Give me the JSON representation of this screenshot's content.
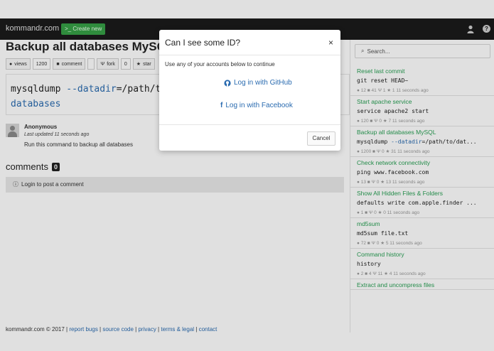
{
  "navbar": {
    "brand": "kommandr.com",
    "create_label": ">_ Create new"
  },
  "main": {
    "title": "Backup all databases MySQL",
    "buttons": [
      {
        "icon": "eye-icon",
        "label": "views",
        "count": "1200"
      },
      {
        "icon": "comment-icon",
        "label": "comment",
        "count": ""
      },
      {
        "icon": "fork-icon",
        "label": "fork",
        "count": "0"
      },
      {
        "icon": "star-icon",
        "label": "star",
        "count": ""
      }
    ],
    "code": {
      "cmd": "mysqldump ",
      "arg": "--datadir",
      "rest": "=/path/t",
      "line2": "databases"
    },
    "author": {
      "name": "Anonymous",
      "updated": "Last updated 11 seconds ago",
      "description": "Run this command to backup all databases"
    },
    "comments": {
      "title": "comments",
      "count": "0",
      "login_prompt": "Login to post a comment"
    }
  },
  "footer": {
    "copyright": "kommandr.com © 2017 |",
    "links": [
      "report bugs",
      "source code",
      "privacy",
      "terms & legal",
      "contact"
    ]
  },
  "sidebar": {
    "search_placeholder": "Search...",
    "items": [
      {
        "title": "Reset last commit",
        "cmd": "git reset HEAD~",
        "arg": "",
        "cmd_rest": "",
        "views": "12",
        "comments": "41",
        "forks": "1",
        "stars": "1",
        "time": "11 seconds ago"
      },
      {
        "title": "Start apache service",
        "cmd": "service apache2 start",
        "arg": "",
        "cmd_rest": "",
        "views": "120",
        "comments": "",
        "forks": "0",
        "stars": "7",
        "time": "11 seconds ago"
      },
      {
        "title": "Backup all databases MySQL",
        "cmd": "mysqldump ",
        "arg": "--datadir",
        "cmd_rest": "=/path/to/dat...",
        "views": "1200",
        "comments": "",
        "forks": "0",
        "stars": "31",
        "time": "11 seconds ago"
      },
      {
        "title": "Check network connectivity",
        "cmd": "ping www.facebook.com",
        "arg": "",
        "cmd_rest": "",
        "views": "13",
        "comments": "",
        "forks": "0",
        "stars": "13",
        "time": "11 seconds ago"
      },
      {
        "title": "Show All Hidden Files & Folders",
        "cmd": "defaults write com.apple.finder ...",
        "arg": "",
        "cmd_rest": "",
        "views": "1",
        "comments": "",
        "forks": "0",
        "stars": "0",
        "time": "11 seconds ago"
      },
      {
        "title": "md5sum",
        "cmd": "md5sum file.txt",
        "arg": "",
        "cmd_rest": "",
        "views": "72",
        "comments": "",
        "forks": "0",
        "stars": "5",
        "time": "11 seconds ago"
      },
      {
        "title": "Command history",
        "cmd": "history",
        "arg": "",
        "cmd_rest": "",
        "views": "2",
        "comments": "4",
        "forks": "11",
        "stars": "4",
        "time": "11 seconds ago"
      },
      {
        "title": "Extract and uncompress files",
        "cmd": "",
        "arg": "",
        "cmd_rest": "",
        "views": "",
        "comments": "",
        "forks": "",
        "stars": "",
        "time": ""
      }
    ]
  },
  "modal": {
    "title": "Can I see some ID?",
    "close": "×",
    "description": "Use any of your accounts below to continue",
    "github_label": "Log in with GitHub",
    "facebook_label": "Log in with Facebook",
    "cancel_label": "Cancel"
  },
  "colors": {
    "accent": "#2a6bb0",
    "green": "#2aa055",
    "navbar": "#1b1b1b"
  }
}
